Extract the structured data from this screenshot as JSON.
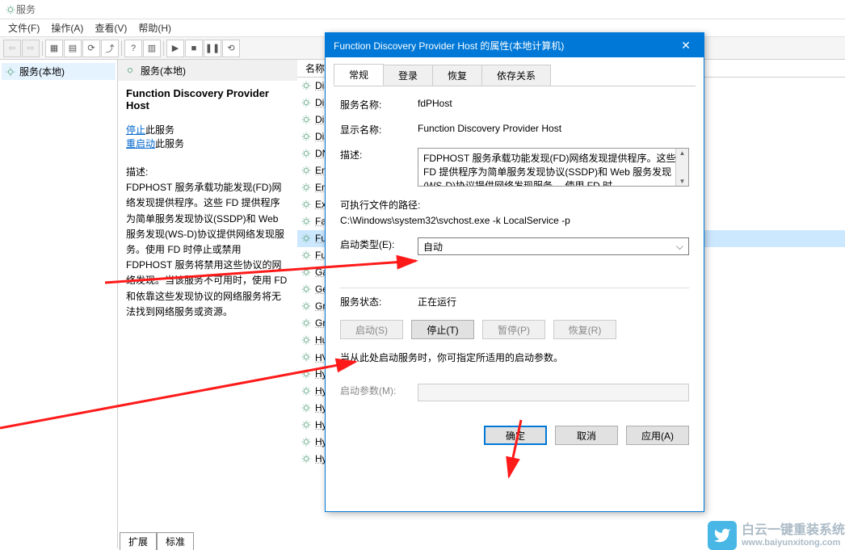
{
  "window": {
    "title": "服务",
    "menus": {
      "file": "文件(F)",
      "action": "操作(A)",
      "view": "查看(V)",
      "help": "帮助(H)"
    },
    "tree_item": "服务(本地)",
    "panel_header": "服务(本地)"
  },
  "detail": {
    "title": "Function Discovery Provider Host",
    "stop_link": "停止",
    "stop_suffix": "此服务",
    "restart_link": "重启动",
    "restart_suffix": "此服务",
    "desc_label": "描述:",
    "desc_body": "FDPHOST 服务承载功能发现(FD)网络发现提供程序。这些 FD 提供程序为简单服务发现协议(SSDP)和 Web 服务发现(WS-D)协议提供网络发现服务。使用 FD 时停止或禁用 FDPHOST 服务将禁用这些协议的网络发现。当该服务不可用时，使用 FD 和依靠这些发现协议的网络服务将无法找到网络服务或资源。"
  },
  "list": {
    "col_name": "名称",
    "items": [
      "Diagno",
      "Diagno",
      "Distribu",
      "Distribu",
      "DNS Cli",
      "Encrypt",
      "Enterpr",
      "Extensil",
      "Fax",
      "Functio",
      "Functio",
      "GameD",
      "Geoloc",
      "Graphic",
      "Group I",
      "Human",
      "HV 主机",
      "Hyper-",
      "Hyper-V",
      "Hyper-V",
      "Hyper-V",
      "Hyper-V",
      "Hyper-V"
    ],
    "selected_index": 9
  },
  "tabs_bottom": {
    "extend": "扩展",
    "standard": "标准"
  },
  "dialog": {
    "title": "Function Discovery Provider Host 的属性(本地计算机)",
    "close": "✕",
    "tabs": {
      "general": "常规",
      "logon": "登录",
      "recovery": "恢复",
      "dependencies": "依存关系"
    },
    "service_name_label": "服务名称:",
    "service_name": "fdPHost",
    "display_name_label": "显示名称:",
    "display_name": "Function Discovery Provider Host",
    "desc_label": "描述:",
    "desc_body": "FDPHOST 服务承载功能发现(FD)网络发现提供程序。这些 FD 提供程序为简单服务发现协议(SSDP)和 Web 服务发现(WS-D)协议提供网络发现服务。 使用 FD 时",
    "exe_label": "可执行文件的路径:",
    "exe_path": "C:\\Windows\\system32\\svchost.exe -k LocalService -p",
    "startup_label": "启动类型(E):",
    "startup_value": "自动",
    "status_label": "服务状态:",
    "status_value": "正在运行",
    "btn_start": "启动(S)",
    "btn_stop": "停止(T)",
    "btn_pause": "暂停(P)",
    "btn_resume": "恢复(R)",
    "start_hint": "当从此处启动服务时，你可指定所适用的启动参数。",
    "start_params_label": "启动参数(M):",
    "btn_ok": "确定",
    "btn_cancel": "取消",
    "btn_apply": "应用(A)"
  },
  "watermark": {
    "name": "白云一键重装系统",
    "url": "www.baiyunxitong.com"
  }
}
